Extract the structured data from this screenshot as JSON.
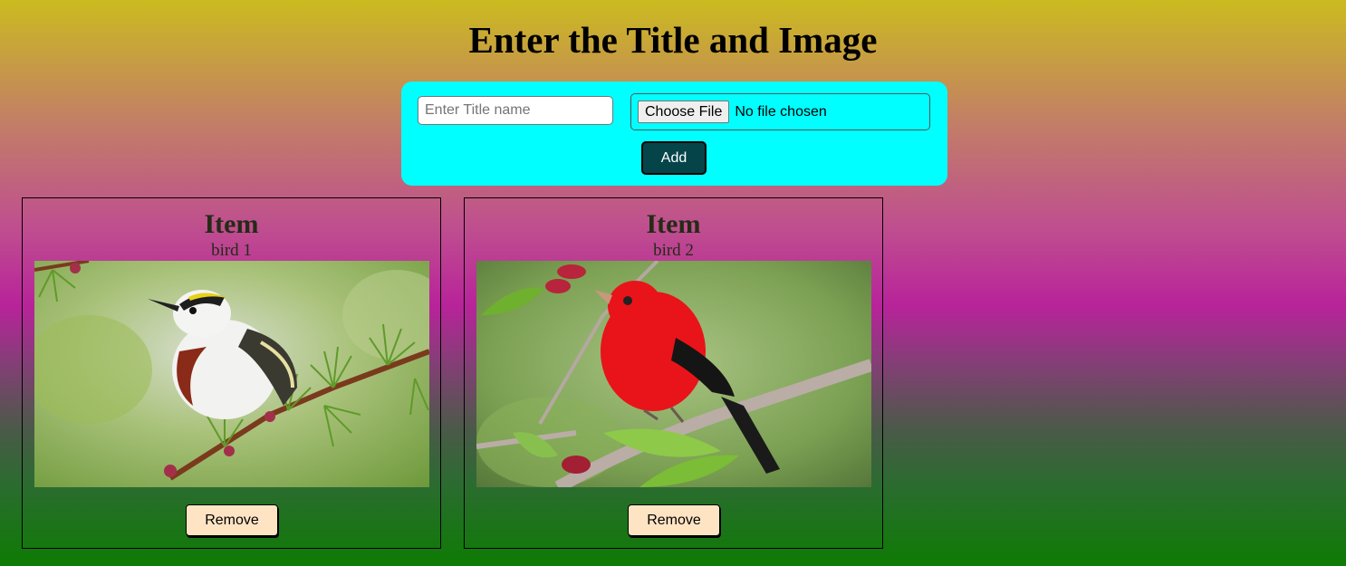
{
  "header": {
    "title": "Enter the Title and Image"
  },
  "form": {
    "title_placeholder": "Enter Title name",
    "title_value": "",
    "choose_file_label": "Choose File",
    "file_status": "No file chosen",
    "add_label": "Add"
  },
  "cards": [
    {
      "heading": "Item",
      "title": "bird 1",
      "image": "chestnut-sided-warbler-on-larch-branch",
      "remove_label": "Remove"
    },
    {
      "heading": "Item",
      "title": "bird 2",
      "image": "scarlet-tanager-on-mulberry-branch",
      "remove_label": "Remove"
    }
  ],
  "colors": {
    "form_panel": "#00ffff",
    "add_button": "#05454a",
    "remove_button": "#ffe4c4",
    "heading_text": "#242b16"
  }
}
